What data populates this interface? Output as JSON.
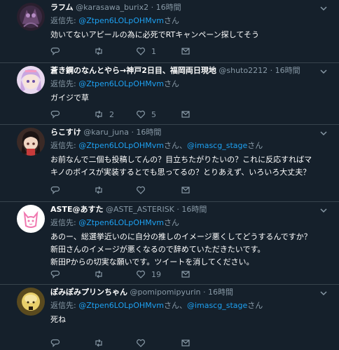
{
  "tweets": [
    {
      "name": "ラフム",
      "handle": "@karasawa_burix2",
      "dot": "·",
      "time": "16時間",
      "reply_prefix": "返信先: ",
      "reply_to_1": "@Ztpen6LOLpOHMvm",
      "reply_mid": "",
      "reply_to_2": "",
      "reply_suffix": "さん",
      "text": "効いてないアピールの為に必死でRTキャンペーン探してそう",
      "reply_count": "",
      "retweet_count": "",
      "like_count": "1"
    },
    {
      "name": "蒼き鋼のなんとやら→神戸2日目、福岡両日現地",
      "handle": "@shuto2212",
      "dot": "·",
      "time": "16時間",
      "reply_prefix": "返信先: ",
      "reply_to_1": "@Ztpen6LOLpOHMvm",
      "reply_mid": "",
      "reply_to_2": "",
      "reply_suffix": "さん",
      "text": "ガイジで草",
      "reply_count": "",
      "retweet_count": "2",
      "like_count": "5"
    },
    {
      "name": "らこすけ",
      "handle": "@karu_juna",
      "dot": "·",
      "time": "16時間",
      "reply_prefix": "返信先: ",
      "reply_to_1": "@Ztpen6LOLpOHMvm",
      "reply_mid": "さん、",
      "reply_to_2": "@imascg_stage",
      "reply_suffix": "さん",
      "text": "お前なんで二個も投稿してんの？目立ちたがりたいの？これに反応すればマキノのボイスが実装するとでも思ってるの？とりあえず、いろいろ大丈夫？",
      "reply_count": "",
      "retweet_count": "",
      "like_count": ""
    },
    {
      "name": "ASTE@あすた",
      "handle": "@ASTE_ASTERISK",
      "dot": "·",
      "time": "16時間",
      "reply_prefix": "返信先: ",
      "reply_to_1": "@Ztpen6LOLpOHMvm",
      "reply_mid": "",
      "reply_to_2": "",
      "reply_suffix": "さん",
      "text_lines": [
        "あのー、総選挙近いのに自分の推しのイメージ悪くしてどうするんですか？",
        "新田さんのイメージが悪くなるので辞めていただきたいです。",
        "新田Pからの切実な願いです。ツイートを消してください。"
      ],
      "reply_count": "",
      "retweet_count": "",
      "like_count": "19"
    },
    {
      "name": "ぽみぽみプリンちゃん",
      "handle": "@pomipomipyurin",
      "dot": "·",
      "time": "16時間",
      "reply_prefix": "返信先: ",
      "reply_to_1": "@Ztpen6LOLpOHMvm",
      "reply_mid": "さん、",
      "reply_to_2": "@imascg_stage",
      "reply_suffix": "さん",
      "text": "死ね",
      "reply_count": "",
      "retweet_count": "",
      "like_count": ""
    }
  ],
  "icons": {
    "reply": "reply-icon",
    "retweet": "retweet-icon",
    "like": "heart-icon",
    "share": "share-icon",
    "caret": "chevron-down-icon"
  },
  "colors": {
    "background": "#15202b",
    "divider": "#38444d",
    "muted": "#8899a6",
    "link": "#1da1f2",
    "text": "#ffffff"
  }
}
